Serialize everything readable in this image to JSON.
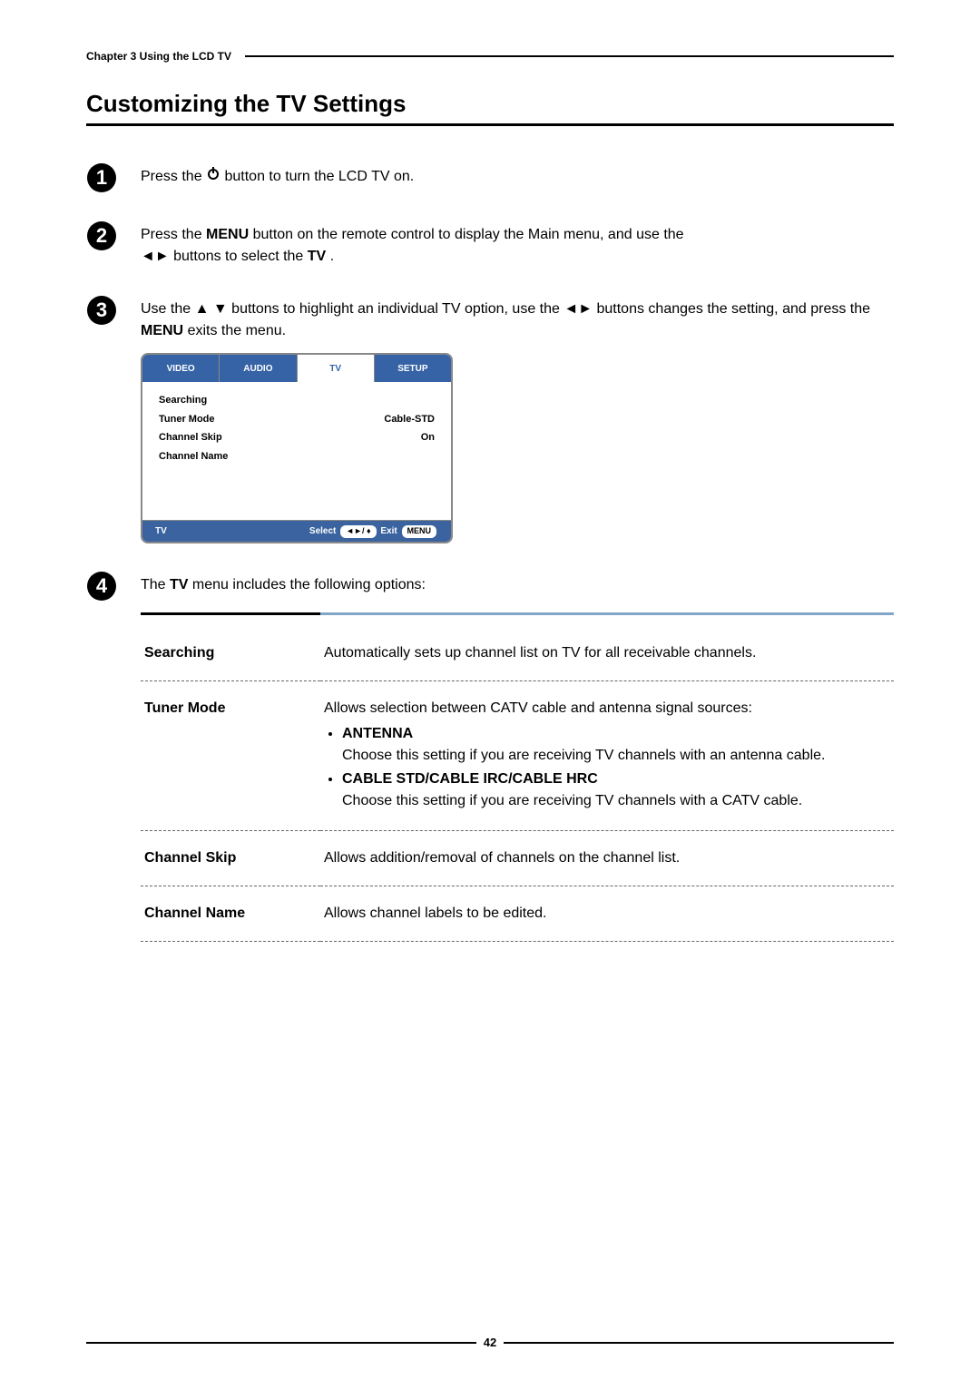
{
  "chapter": "Chapter 3 Using the LCD TV",
  "section_title": "Customizing the TV Settings",
  "steps": {
    "s1": {
      "pre": "Press the ",
      "post": " button to turn the LCD TV on."
    },
    "s2": {
      "pre": "Press the ",
      "menu": "MENU",
      "mid1": " button on the remote control to display the Main menu, and use the ",
      "mid2": " buttons to select the ",
      "tv": "TV",
      "end": "."
    },
    "s3": {
      "pre": "Use the ",
      "mid1": " buttons to highlight an individual TV option, use the ",
      "mid2": " buttons changes the setting, and press the ",
      "menu": "MENU",
      "end": " exits the menu."
    }
  },
  "menu": {
    "tabs": {
      "video": "VIDEO",
      "audio": "AUDIO",
      "tv": "TV",
      "setup": "SETUP"
    },
    "rows": {
      "r1": {
        "label": "Searching",
        "value": ""
      },
      "r2": {
        "label": "Tuner Mode",
        "value": "Cable-STD"
      },
      "r3": {
        "label": "Channel Skip",
        "value": "On"
      },
      "r4": {
        "label": "Channel Name",
        "value": ""
      }
    },
    "footer_left": "TV",
    "footer_select": "Select",
    "footer_keys": "◄►/ ♦",
    "footer_exit": "Exit",
    "footer_menu": "MENU"
  },
  "s4_intro_pre": "The ",
  "s4_intro_tv": "TV",
  "s4_intro_post": " menu includes the following options:",
  "options": {
    "searching": {
      "name": "Searching",
      "desc": "Automatically sets up channel list on TV for all receivable channels."
    },
    "tuner": {
      "name": "Tuner Mode",
      "desc": "Allows selection between CATV cable and antenna signal sources:",
      "b1": "ANTENNA",
      "b1_desc": "Choose this setting if you are receiving TV channels with an antenna cable.",
      "b2": "CABLE STD/CABLE IRC/CABLE HRC",
      "b2_desc": "Choose this setting if you are receiving TV channels with a CATV cable."
    },
    "skip": {
      "name": "Channel Skip",
      "desc": "Allows addition/removal of channels on the channel list."
    },
    "cname": {
      "name": "Channel Name",
      "desc": "Allows channel labels to be edited."
    }
  },
  "page_number": "42"
}
